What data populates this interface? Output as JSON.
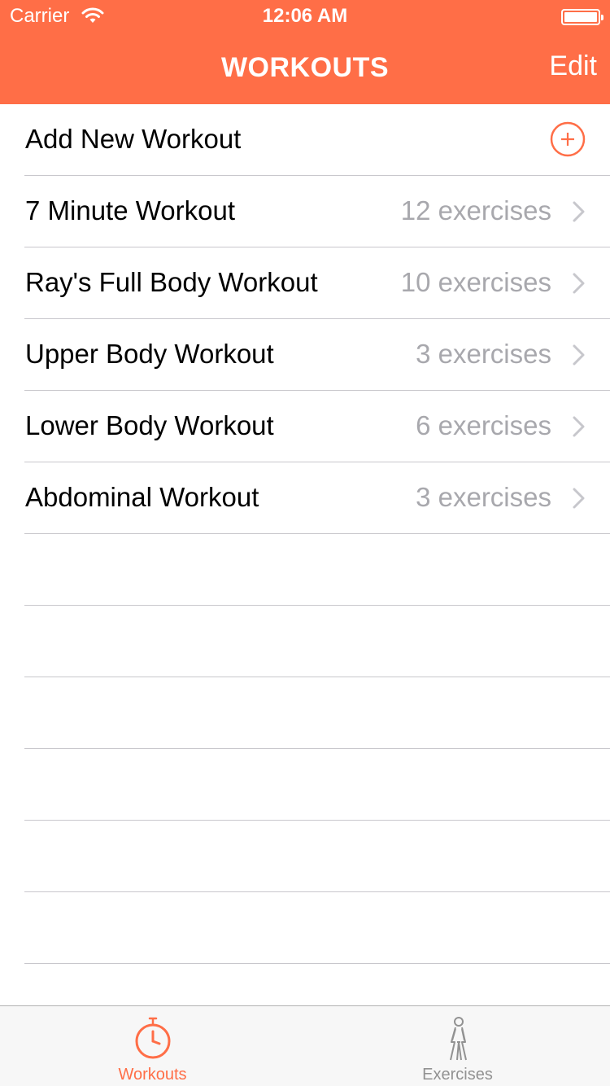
{
  "status_bar": {
    "carrier": "Carrier",
    "time": "12:06 AM"
  },
  "nav": {
    "title": "WORKOUTS",
    "edit_label": "Edit"
  },
  "add_row": {
    "label": "Add New Workout",
    "icon": "plus-circle-icon"
  },
  "workouts": [
    {
      "name": "7 Minute Workout",
      "detail": "12 exercises"
    },
    {
      "name": "Ray's Full Body Workout",
      "detail": "10 exercises"
    },
    {
      "name": "Upper Body Workout",
      "detail": "3 exercises"
    },
    {
      "name": "Lower Body Workout",
      "detail": "6 exercises"
    },
    {
      "name": "Abdominal Workout",
      "detail": "3 exercises"
    }
  ],
  "empty_rows": 6,
  "tabs": [
    {
      "label": "Workouts",
      "icon": "stopwatch-icon",
      "active": true
    },
    {
      "label": "Exercises",
      "icon": "figure-icon",
      "active": false
    }
  ],
  "colors": {
    "accent": "#FF6E47",
    "detail_text": "#a8a8ad",
    "separator": "#c8c7cc",
    "tab_inactive": "#929292"
  }
}
